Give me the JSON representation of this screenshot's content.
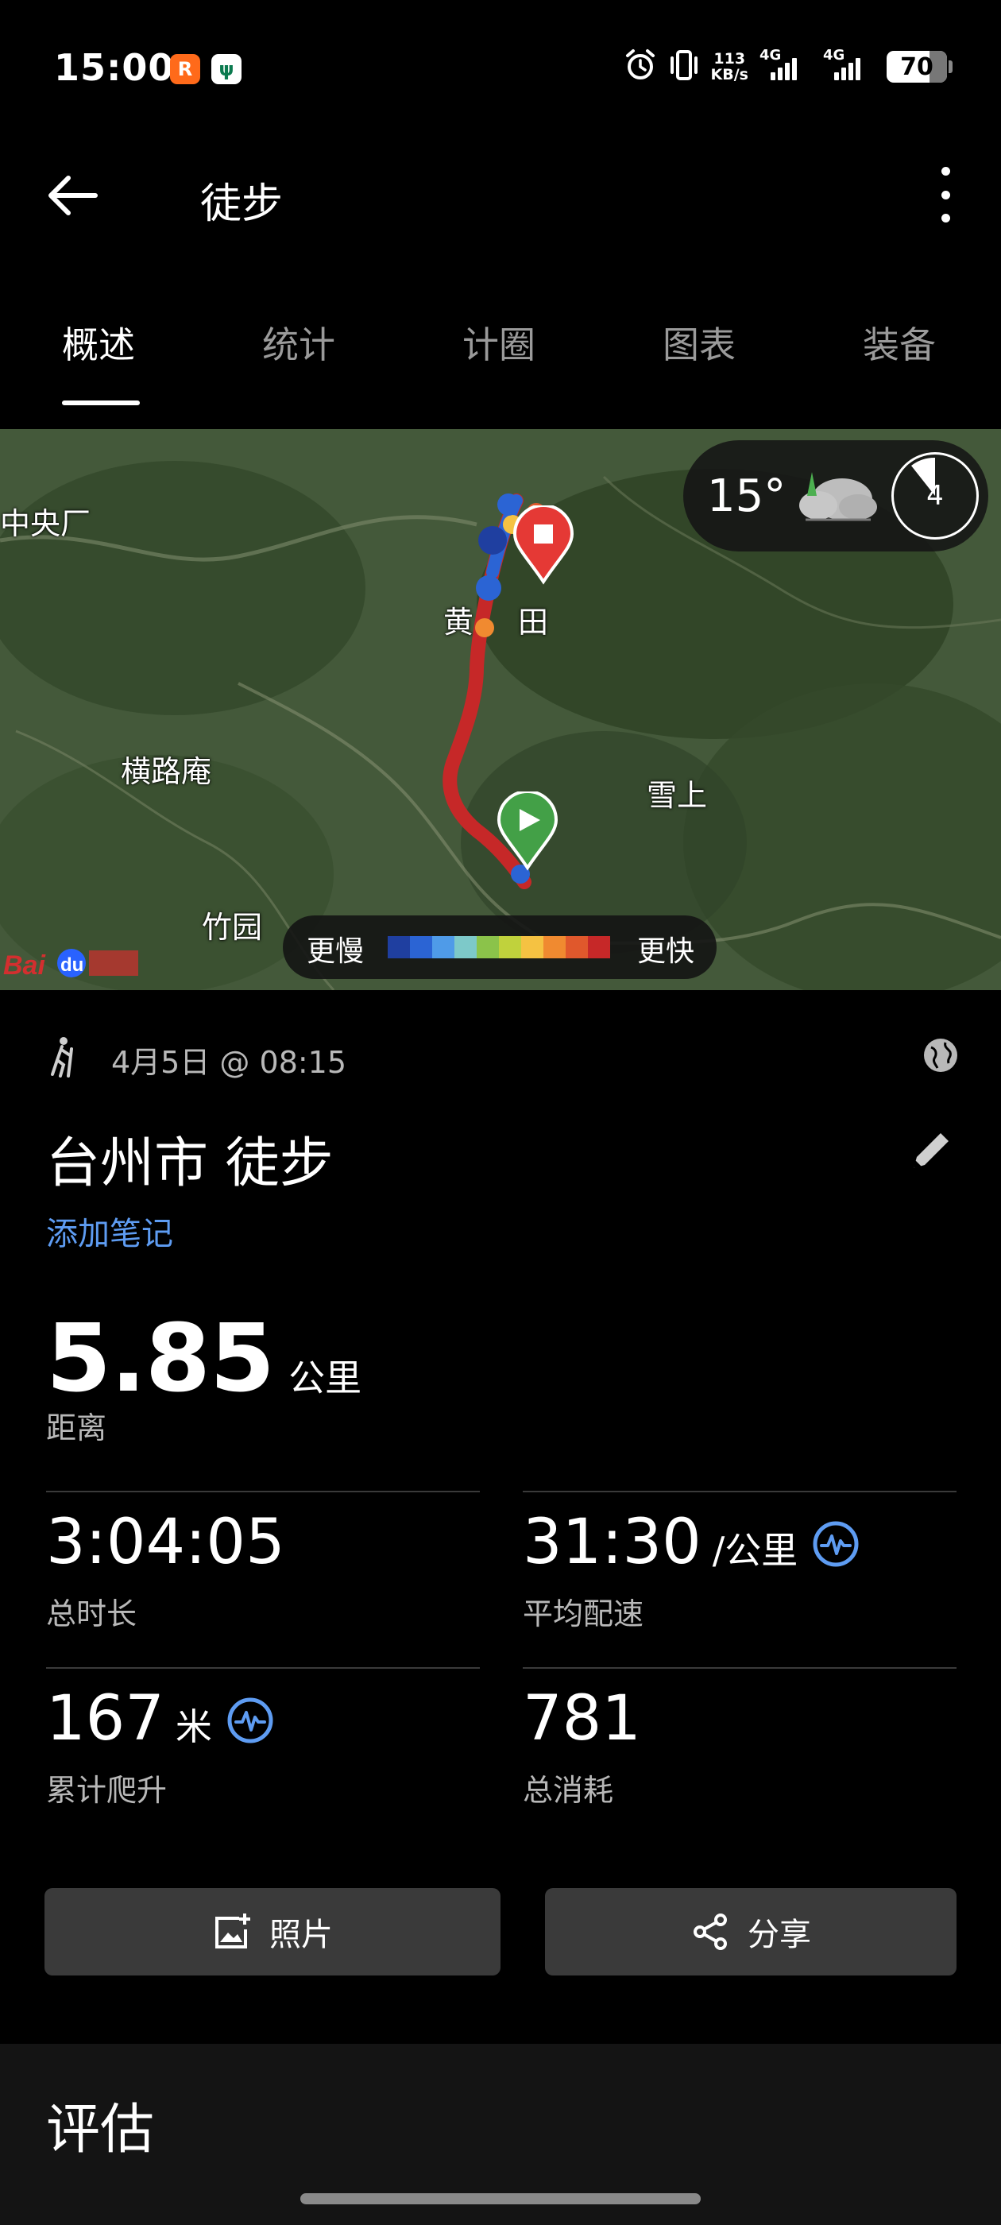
{
  "status_bar": {
    "time": "15:00",
    "app_badge_1": "R",
    "app_badge_2": "ψ",
    "net_speed_value": "113",
    "net_speed_unit": "KB/s",
    "sim1": "4G",
    "sim2": "4G",
    "battery": "70",
    "icons": [
      "alarm-icon",
      "vibrate-icon",
      "signal-icon",
      "battery-icon"
    ]
  },
  "app_bar": {
    "title": "徒步"
  },
  "tabs": [
    {
      "label": "概述",
      "active": true
    },
    {
      "label": "统计",
      "active": false
    },
    {
      "label": "计圈",
      "active": false
    },
    {
      "label": "图表",
      "active": false
    },
    {
      "label": "装备",
      "active": false
    }
  ],
  "map": {
    "places": {
      "p1": "中央厂",
      "p2": "黄",
      "p3": "田",
      "p4": "横路庵",
      "p5": "雪上",
      "p6": "竹园"
    },
    "weather": {
      "temperature": "15°",
      "wind": "4",
      "icon": "cloud-icon"
    },
    "legend": {
      "slower": "更慢",
      "faster": "更快",
      "colors": [
        "#1f3fa0",
        "#2b64d4",
        "#4f9be8",
        "#7dc9c9",
        "#8bc34a",
        "#c0d23c",
        "#f5c242",
        "#f08a30",
        "#e0582c",
        "#c62828"
      ]
    },
    "watermark": "Bai du 地图"
  },
  "activity": {
    "date": "4月5日 @ 08:15",
    "title": "台州市 徒步",
    "add_note": "添加笔记",
    "distance_value": "5.85",
    "distance_unit": "公里",
    "distance_label": "距离",
    "stats": {
      "duration_value": "3:04:05",
      "duration_label": "总时长",
      "pace_value": "31:30",
      "pace_unit": "/公里",
      "pace_label": "平均配速",
      "ascent_value": "167",
      "ascent_unit": "米",
      "ascent_label": "累计爬升",
      "calories_value": "781",
      "calories_label": "总消耗"
    }
  },
  "buttons": {
    "photo": "照片",
    "share": "分享"
  },
  "evaluation": {
    "title": "评估"
  }
}
